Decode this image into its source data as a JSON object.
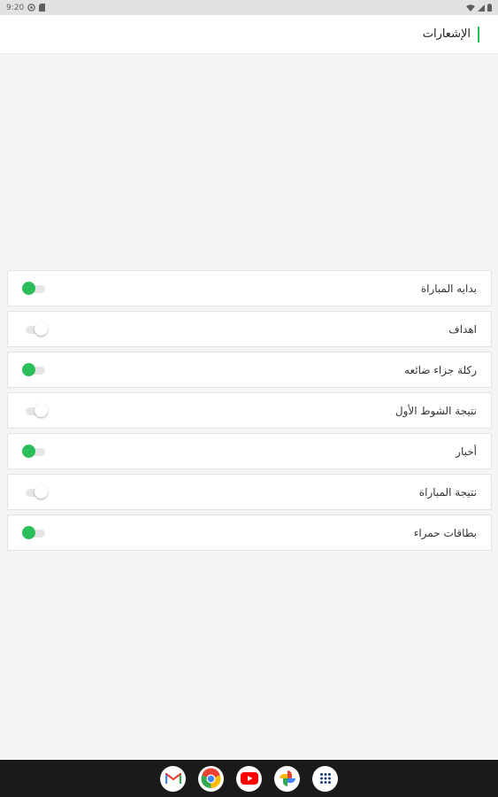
{
  "status_bar": {
    "time": "9:20"
  },
  "header": {
    "title": "الإشعارات",
    "accent_color": "#2bbf5c"
  },
  "settings": [
    {
      "label": "بدايه المباراة",
      "enabled": true
    },
    {
      "label": "اهداف",
      "enabled": false
    },
    {
      "label": "ركلة جزاء ضائعه",
      "enabled": true
    },
    {
      "label": "نتيجة الشوط الأول",
      "enabled": false
    },
    {
      "label": "أخبار",
      "enabled": true
    },
    {
      "label": "نتيجة المباراة",
      "enabled": false
    },
    {
      "label": "بطاقات حمراء",
      "enabled": true
    }
  ],
  "dock": {
    "apps": [
      "gmail-icon",
      "chrome-icon",
      "youtube-icon",
      "photos-icon",
      "app-drawer-icon"
    ]
  }
}
